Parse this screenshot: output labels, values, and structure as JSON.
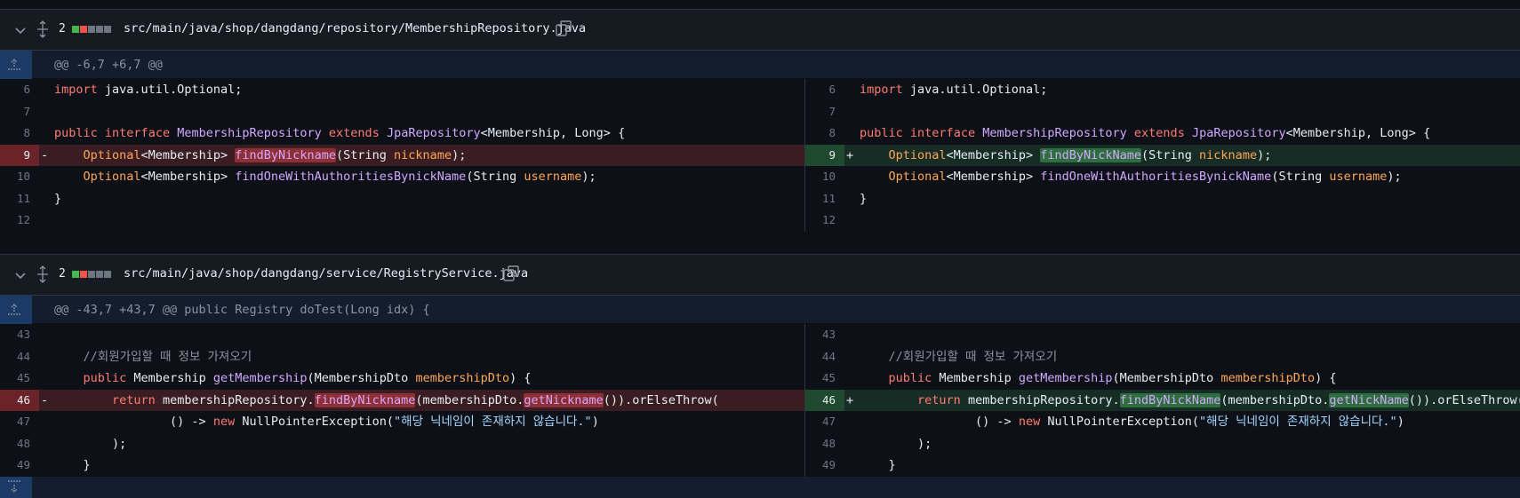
{
  "colors": {
    "diffstat_add": "#3fb950",
    "diffstat_del": "#f85149",
    "diffstat_neutral": "#6e7681"
  },
  "files": [
    {
      "changes": "2",
      "path": "src/main/java/shop/dangdang/repository/MembershipRepository.java",
      "hunk": "@@ -6,7 +6,7 @@",
      "lines": [
        "6",
        "7",
        "8",
        "9",
        "10",
        "11",
        "12"
      ]
    },
    {
      "changes": "2",
      "path": "src/main/java/shop/dangdang/service/RegistryService.java",
      "hunk": "@@ -43,7 +43,7 @@ public Registry doTest(Long idx) {",
      "lines": [
        "43",
        "44",
        "45",
        "46",
        "47",
        "48",
        "49"
      ]
    }
  ],
  "markers": {
    "del": "-",
    "add": "+"
  },
  "code": {
    "f1": {
      "import": "import",
      "import_rest": " java.util.Optional;",
      "public": "public",
      "interface": "interface",
      "iface_name": "MembershipRepository",
      "extends": "extends",
      "jpa": "JpaRepository",
      "generic": "<Membership, Long> {",
      "optional": "Optional",
      "membership_generic": "<Membership> ",
      "find_old": "findByNickname",
      "find_new": "findByNickName",
      "string_param": "(String ",
      "nickname": "nickname",
      "close_semi": ");",
      "find_one": "findOneWithAuthoritiesBynickName",
      "username": "username",
      "close_brace": "}"
    },
    "f2": {
      "comment": "//회원가입할 때 정보 가져오기",
      "public": "public",
      "membership_type": " Membership ",
      "get_membership": "getMembership",
      "dto_param": "(MembershipDto ",
      "dto_var": "membershipDto",
      "paren_brace": ") {",
      "return": "return",
      "repo": " membershipRepository.",
      "find_old": "findByNickname",
      "find_new": "findByNickName",
      "dto_dot": "(membershipDto.",
      "get_old": "getNickname",
      "get_new": "getNickName",
      "or_else": "()).orElseThrow(",
      "lambda": "() -> ",
      "new": "new",
      "npe": " NullPointerException(",
      "message": "\"해당 닉네임이 존재하지 않습니다.\"",
      "close_paren": ")",
      "close_semi": ");",
      "close_brace": "}"
    }
  }
}
